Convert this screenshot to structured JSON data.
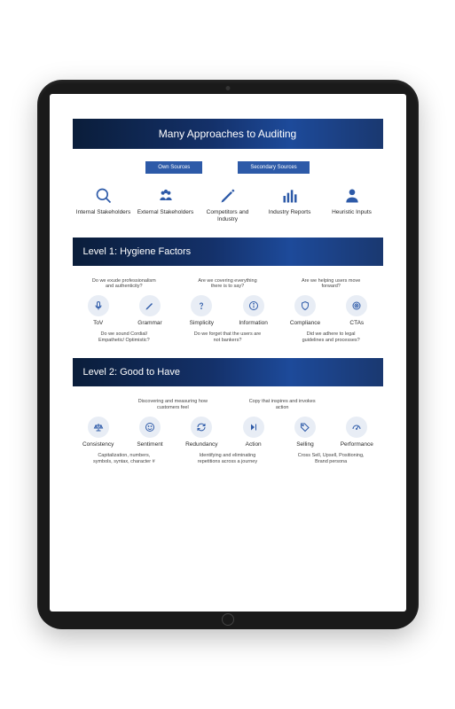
{
  "header": {
    "title": "Many Approaches to Auditing"
  },
  "sourceTags": {
    "own": "Own Sources",
    "secondary": "Secondary Sources"
  },
  "approaches": [
    {
      "icon": "search-icon",
      "label": "Internal Stakeholders"
    },
    {
      "icon": "group-icon",
      "label": "External Stakeholders"
    },
    {
      "icon": "pencil-icon",
      "label": "Competitors and Industry"
    },
    {
      "icon": "barchart-icon",
      "label": "Industry Reports"
    },
    {
      "icon": "person-icon",
      "label": "Heuristic Inputs"
    }
  ],
  "level1": {
    "title": "Level 1: Hygiene Factors",
    "questionsTop": [
      "Do we exude professionalism and authenticity?",
      "Are we covering everything there is to say?",
      "Are we helping users move forward?"
    ],
    "items": [
      {
        "icon": "voice-icon",
        "label": "ToV"
      },
      {
        "icon": "pencil-icon",
        "label": "Grammar"
      },
      {
        "icon": "question-icon",
        "label": "Simplicity"
      },
      {
        "icon": "info-icon",
        "label": "Information"
      },
      {
        "icon": "shield-icon",
        "label": "Compliance"
      },
      {
        "icon": "target-icon",
        "label": "CTAs"
      }
    ],
    "questionsBottom": [
      "Do we sound Cordial/ Empathetic/ Optimistic?",
      "Do we forget that the users are not bankers?",
      "Did we adhere to legal guidelines and processes?"
    ]
  },
  "level2": {
    "title": "Level 2: Good to Have",
    "questionsTop": [
      "Discovering and measuring how customers feel",
      "Copy that inspires and invokes action"
    ],
    "items": [
      {
        "icon": "scales-icon",
        "label": "Consistency"
      },
      {
        "icon": "smile-icon",
        "label": "Sentiment"
      },
      {
        "icon": "refresh-icon",
        "label": "Redundancy"
      },
      {
        "icon": "forward-icon",
        "label": "Action"
      },
      {
        "icon": "tag-icon",
        "label": "Selling"
      },
      {
        "icon": "gauge-icon",
        "label": "Performance"
      }
    ],
    "questionsBottom": [
      "Capitalization, numbers, symbols, syntax, character #",
      "Identifying and eliminating repetitions across a journey",
      "Cross Sell, Upsell, Positioning, Brand persona"
    ]
  }
}
